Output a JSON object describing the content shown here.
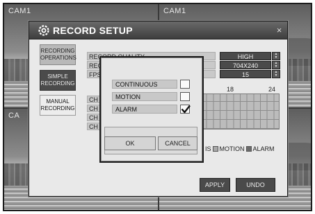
{
  "cameras": [
    {
      "label": "CAM1"
    },
    {
      "label": "CAM1"
    },
    {
      "label": "CA"
    }
  ],
  "window": {
    "title": "RECORD SETUP",
    "close_label": "×"
  },
  "side_menu": [
    {
      "label": "RECORDING OPERATIONS"
    },
    {
      "label": "SIMPLE RECORDING"
    },
    {
      "label": "MANUAL RECORDING"
    }
  ],
  "settings": [
    {
      "label": "RECORD QUALITY",
      "value": "HIGH"
    },
    {
      "label": "REC",
      "value": "704X240"
    },
    {
      "label": "FPS",
      "value": "15"
    }
  ],
  "schedule": {
    "hour_labels": [
      "18",
      "24"
    ],
    "channels": [
      "CH",
      "CH",
      "CH",
      "CH"
    ]
  },
  "legend": {
    "first_partial": "IS",
    "motion": "MOTION",
    "alarm": "ALARM"
  },
  "buttons": {
    "apply": "APPLY",
    "undo": "UNDO"
  },
  "popup": {
    "modes": [
      {
        "label": "CONTINUOUS",
        "checked": false
      },
      {
        "label": "MOTION",
        "checked": false
      },
      {
        "label": "ALARM",
        "checked": true
      }
    ],
    "ok": "OK",
    "cancel": "CANCEL"
  }
}
